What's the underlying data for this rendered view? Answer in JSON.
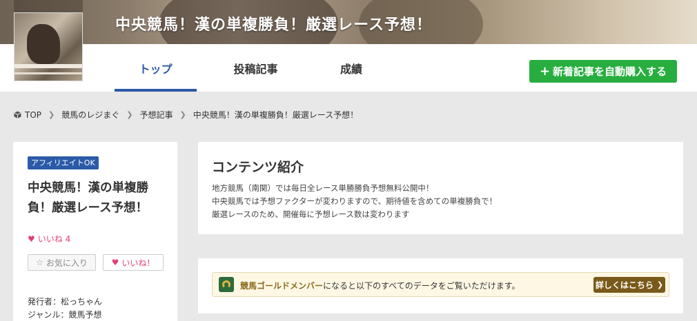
{
  "header": {
    "title": "中央競馬！漢の単複勝負！厳選レース予想！"
  },
  "nav": {
    "tabs": [
      {
        "label": "トップ",
        "active": true
      },
      {
        "label": "投稿記事",
        "active": false
      },
      {
        "label": "成績",
        "active": false
      }
    ],
    "buy_button": "新着記事を自動購入する"
  },
  "breadcrumb": {
    "items": [
      "TOP",
      "競馬のレジまぐ",
      "予想記事",
      "中央競馬！漢の単複勝負！厳選レース予想！"
    ]
  },
  "sidebar": {
    "badge": "アフィリエイトOK",
    "title": "中央競馬！漢の単複勝負！厳選レース予想！",
    "like_count": "いいね 4",
    "favorite_label": "お気に入り",
    "like_label": "いいね！",
    "publisher": "発行者：松っちゃん",
    "genre": "ジャンル：競馬予想"
  },
  "intro": {
    "heading": "コンテンツ紹介",
    "lines": [
      "地方競馬（南関）では毎日全レース単勝勝負予想無料公開中！",
      "中央競馬では予想ファクターが変わりますので、期待値を含めての単複勝負で！",
      "厳選レースのため、開催毎に予想レース数は変わります"
    ]
  },
  "gold": {
    "member_name": "競馬ゴールドメンバー",
    "text_suffix": "になると以下のすべてのデータをご覧いただけます。",
    "detail_button": "詳しくはこちら"
  },
  "colors": {
    "accent_blue": "#2b5aa8",
    "buy_green": "#27ae3f",
    "like_pink": "#e0407a",
    "gold_brown": "#7a5a1a"
  },
  "icons": {
    "plus": "plus-icon",
    "home": "cube-icon",
    "chevron": "chevron-right-icon",
    "heart": "heart-icon",
    "star": "star-icon",
    "horseshoe": "horseshoe-icon"
  }
}
